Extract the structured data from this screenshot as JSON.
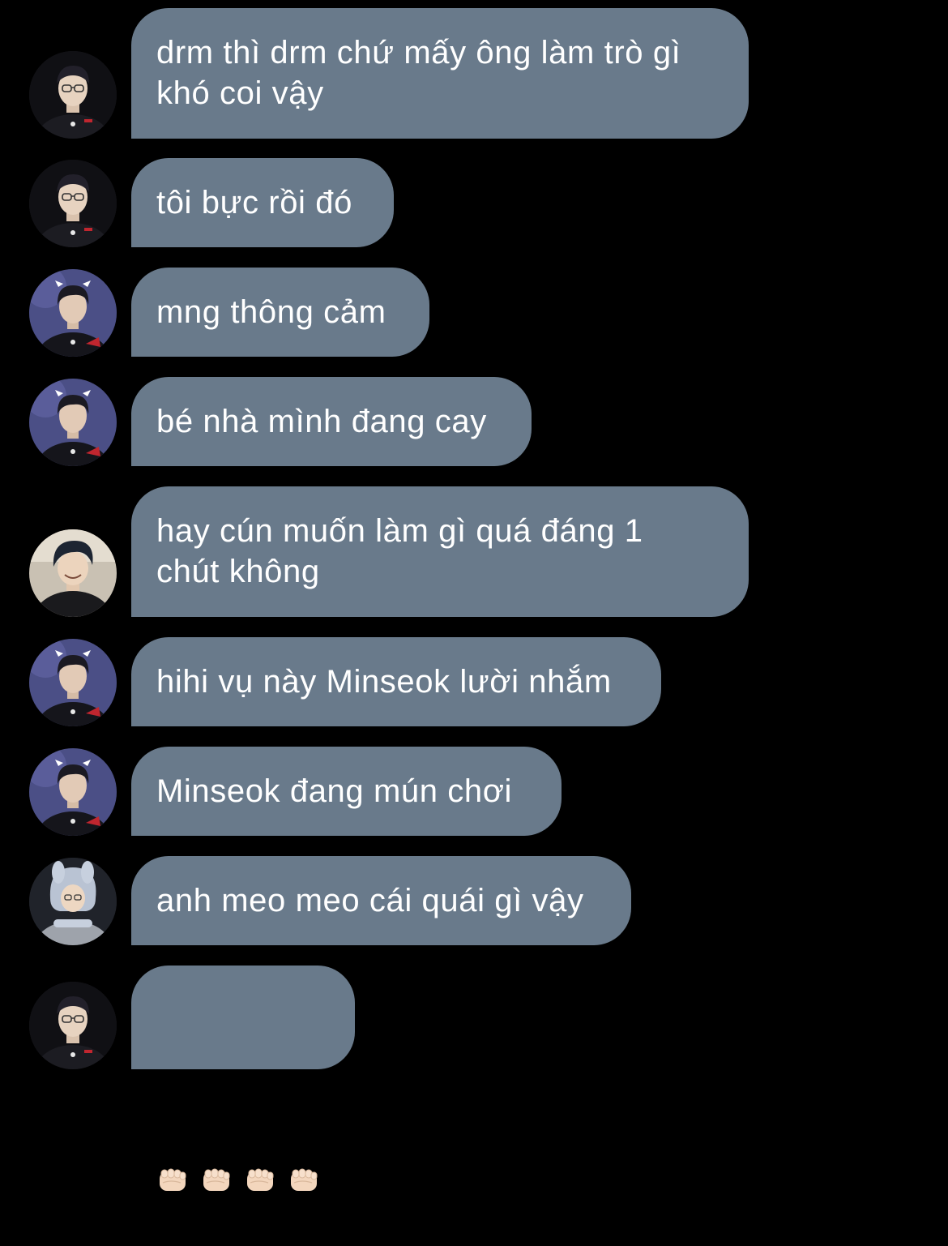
{
  "messages": [
    {
      "sender": "avatar-a",
      "text": "drm thì drm chứ mấy ông làm trò gì\nkhó coi vậy"
    },
    {
      "sender": "avatar-a",
      "text": "tôi bực rồi đó"
    },
    {
      "sender": "avatar-b",
      "text": "mng thông cảm"
    },
    {
      "sender": "avatar-b",
      "text": "bé nhà mình đang cay"
    },
    {
      "sender": "avatar-c",
      "text": "hay cún muốn làm gì quá đáng 1\nchút không"
    },
    {
      "sender": "avatar-b",
      "text": "hihi vụ này Minseok lười nhắm"
    },
    {
      "sender": "avatar-b",
      "text": "Minseok đang mún chơi"
    },
    {
      "sender": "avatar-d",
      "text": "anh meo meo cái quái gì vậy"
    },
    {
      "sender": "avatar-a",
      "emoji": [
        "oncoming-fist",
        "oncoming-fist",
        "oncoming-fist",
        "oncoming-fist"
      ]
    }
  ],
  "colors": {
    "background": "#000000",
    "bubble": "#697a8b",
    "text": "#ffffff"
  }
}
